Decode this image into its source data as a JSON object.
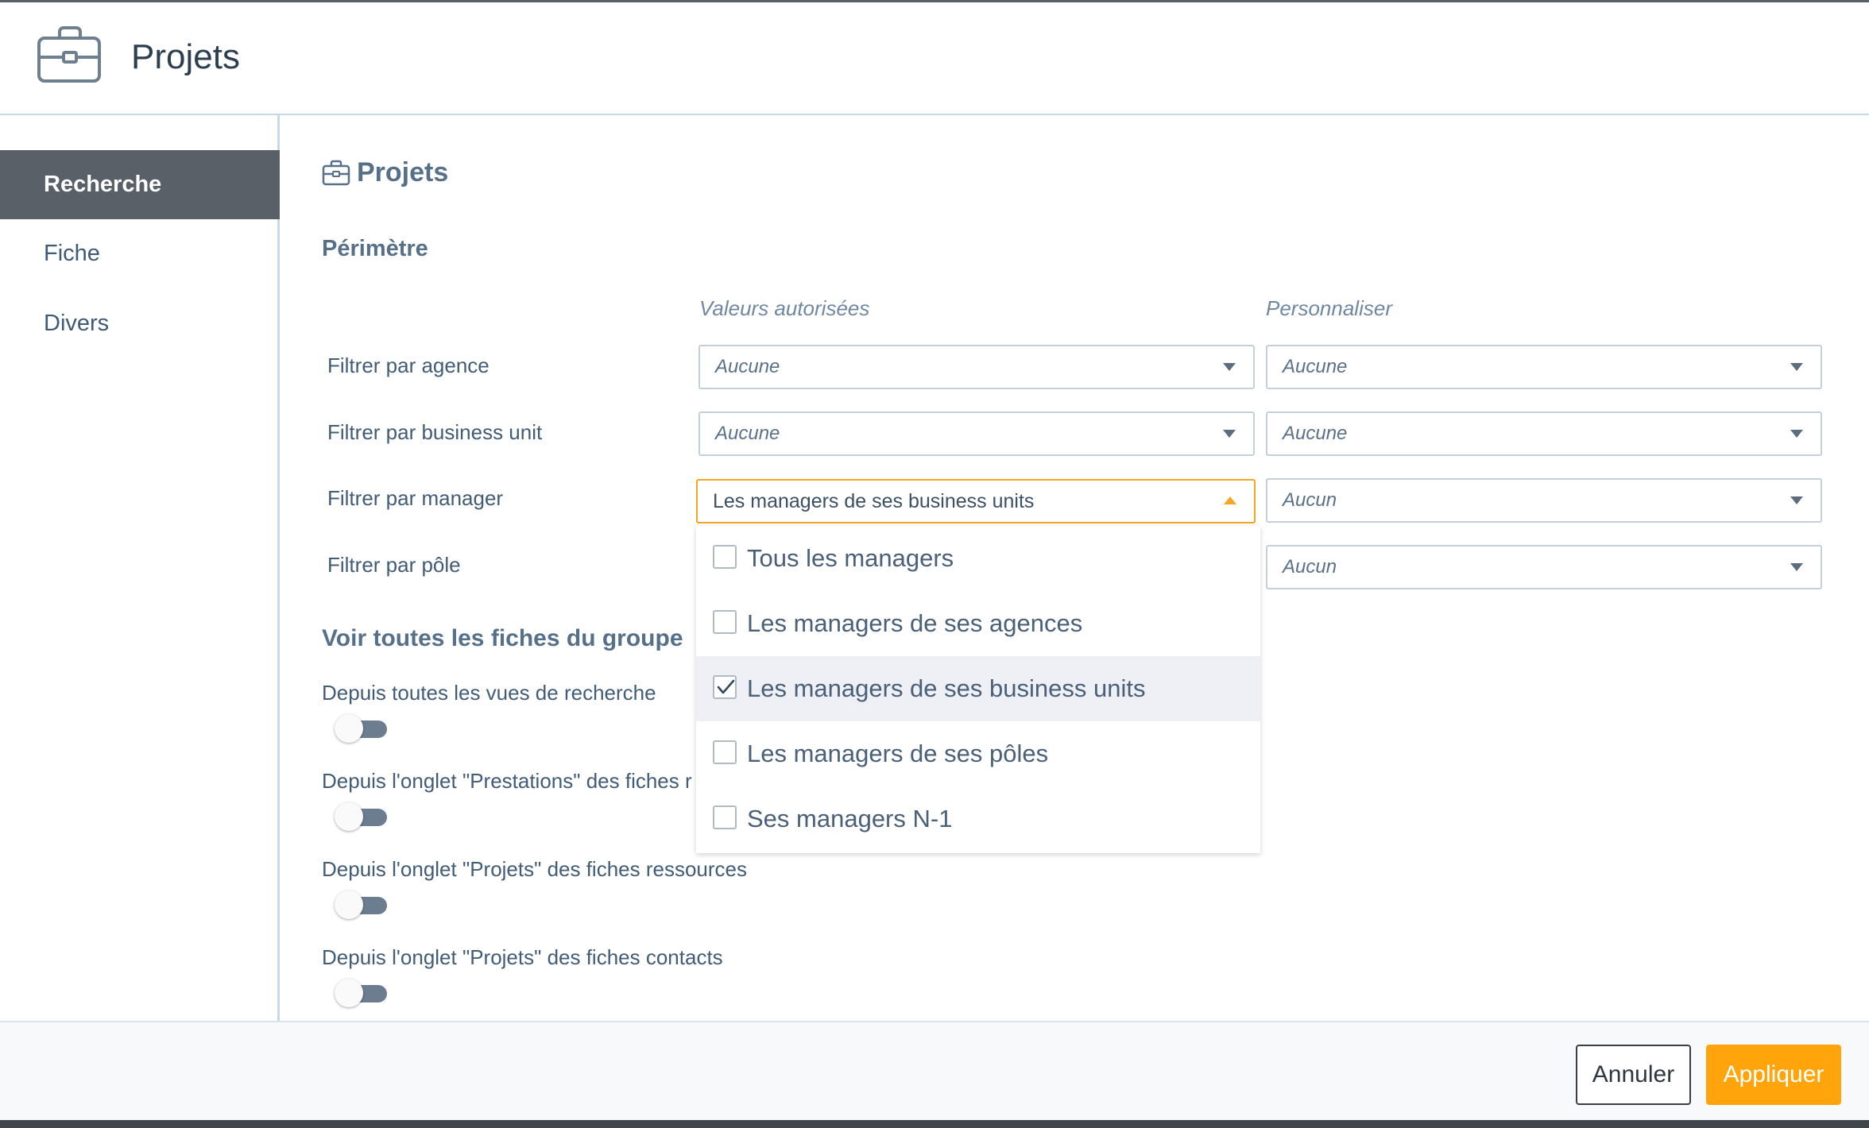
{
  "window": {
    "title": "Projets"
  },
  "sidebar": {
    "items": [
      {
        "label": "Recherche",
        "active": true
      },
      {
        "label": "Fiche",
        "active": false
      },
      {
        "label": "Divers",
        "active": false
      }
    ]
  },
  "main": {
    "title": "Projets",
    "perimetre": {
      "title": "Périmètre",
      "columns": [
        "Valeurs autorisées",
        "Personnaliser"
      ],
      "rows": [
        {
          "label": "Filtrer par agence",
          "allowed": "Aucune",
          "custom": "Aucune"
        },
        {
          "label": "Filtrer par business unit",
          "allowed": "Aucune",
          "custom": "Aucune"
        },
        {
          "label": "Filtrer par manager",
          "allowed": "Les managers de ses business units",
          "custom": "Aucun"
        },
        {
          "label": "Filtrer par pôle",
          "allowed": "",
          "custom": "Aucun"
        }
      ]
    },
    "dropdown": {
      "options": [
        {
          "label": "Tous les managers",
          "checked": false
        },
        {
          "label": "Les managers de ses agences",
          "checked": false
        },
        {
          "label": "Les managers de ses business units",
          "checked": true
        },
        {
          "label": "Les managers de ses pôles",
          "checked": false
        },
        {
          "label": "Ses managers N-1",
          "checked": false
        }
      ]
    },
    "group": {
      "title": "Voir toutes les fiches du groupe",
      "toggles": [
        {
          "label": "Depuis toutes les vues de recherche",
          "on": false
        },
        {
          "label": "Depuis l'onglet \"Prestations\" des fiches r",
          "on": false
        },
        {
          "label": "Depuis l'onglet \"Projets\" des fiches ressources",
          "on": false
        },
        {
          "label": "Depuis l'onglet \"Projets\" des fiches contacts",
          "on": false
        }
      ]
    }
  },
  "footer": {
    "cancel_label": "Annuler",
    "apply_label": "Appliquer"
  },
  "colors": {
    "accent": "#ffa40b",
    "sidebar_active": "#5a6067",
    "heading": "#56708a"
  }
}
